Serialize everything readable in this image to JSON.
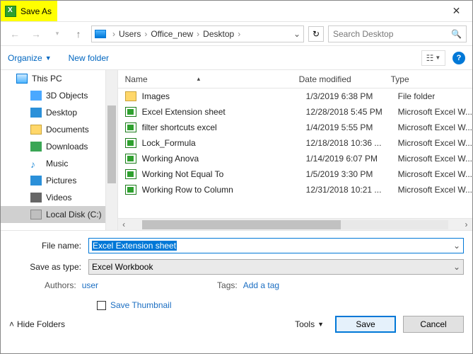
{
  "title": "Save As",
  "breadcrumb": {
    "root": "Users",
    "mid": "Office_new",
    "leaf": "Desktop"
  },
  "search": {
    "placeholder": "Search Desktop"
  },
  "toolbar": {
    "organize": "Organize",
    "newfolder": "New folder"
  },
  "sidebar": {
    "thispc": "This PC",
    "items": [
      {
        "label": "3D Objects"
      },
      {
        "label": "Desktop"
      },
      {
        "label": "Documents"
      },
      {
        "label": "Downloads"
      },
      {
        "label": "Music"
      },
      {
        "label": "Pictures"
      },
      {
        "label": "Videos"
      },
      {
        "label": "Local Disk (C:)"
      }
    ]
  },
  "columns": {
    "name": "Name",
    "date": "Date modified",
    "type": "Type"
  },
  "files": [
    {
      "name": "Images",
      "date": "1/3/2019 6:38 PM",
      "type": "File folder",
      "kind": "folder"
    },
    {
      "name": "Excel Extension sheet",
      "date": "12/28/2018 5:45 PM",
      "type": "Microsoft Excel W...",
      "kind": "xls"
    },
    {
      "name": "filter shortcuts excel",
      "date": "1/4/2019 5:55 PM",
      "type": "Microsoft Excel W...",
      "kind": "xls"
    },
    {
      "name": "Lock_Formula",
      "date": "12/18/2018 10:36 ...",
      "type": "Microsoft Excel W...",
      "kind": "xls"
    },
    {
      "name": "Working Anova",
      "date": "1/14/2019 6:07 PM",
      "type": "Microsoft Excel W...",
      "kind": "xls"
    },
    {
      "name": "Working Not Equal To",
      "date": "1/5/2019 3:30 PM",
      "type": "Microsoft Excel W...",
      "kind": "xls"
    },
    {
      "name": "Working Row to Column",
      "date": "12/31/2018 10:21 ...",
      "type": "Microsoft Excel W...",
      "kind": "xls"
    }
  ],
  "form": {
    "fname_label": "File name:",
    "fname_value": "Excel Extension sheet",
    "stype_label": "Save as type:",
    "stype_value": "Excel Workbook",
    "authors_label": "Authors:",
    "authors_value": "user",
    "tags_label": "Tags:",
    "tags_value": "Add a tag",
    "thumb_label": "Save Thumbnail",
    "hide_label": "Hide Folders",
    "tools_label": "Tools",
    "save_label": "Save",
    "cancel_label": "Cancel"
  }
}
